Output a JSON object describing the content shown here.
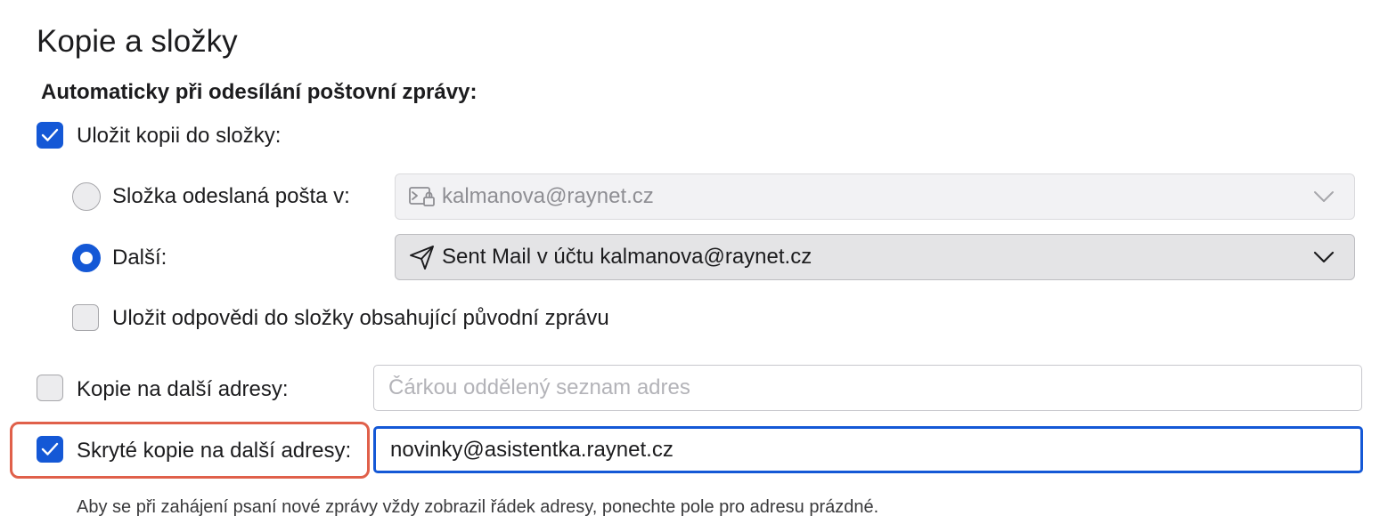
{
  "page": {
    "title": "Kopie a složky",
    "section_heading": "Automaticky při odesílání poštovní zprávy:"
  },
  "save_copy": {
    "label": "Uložit kopii do složky:",
    "checked": true
  },
  "sent_folder_option": {
    "label": "Složka odeslaná pošta v:",
    "selected": false,
    "select_value": "kalmanova@raynet.cz",
    "icon": "mail-account-lock-icon",
    "disabled": true
  },
  "other_folder_option": {
    "label": "Další:",
    "selected": true,
    "select_value": "Sent Mail v účtu kalmanova@raynet.cz",
    "icon": "paper-plane-icon"
  },
  "save_replies": {
    "label": "Uložit odpovědi do složky obsahující původní zprávu",
    "checked": false
  },
  "cc": {
    "label": "Kopie na další adresy:",
    "checked": false,
    "value": "",
    "placeholder": "Čárkou oddělený seznam adres"
  },
  "bcc": {
    "label": "Skryté kopie na další adresy:",
    "checked": true,
    "value": "novinky@asistentka.raynet.cz"
  },
  "hint": "Aby se při zahájení psaní nové zprávy vždy zobrazil řádek adresy, ponechte pole pro adresu prázdné.",
  "colors": {
    "accent": "#1458d6",
    "highlight": "#e0604a"
  }
}
